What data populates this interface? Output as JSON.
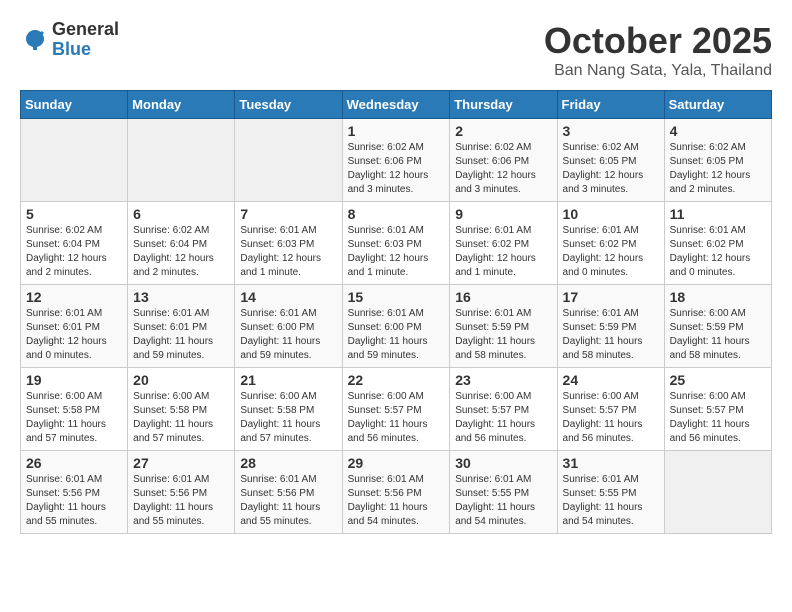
{
  "logo": {
    "general": "General",
    "blue": "Blue"
  },
  "title": "October 2025",
  "subtitle": "Ban Nang Sata, Yala, Thailand",
  "days_header": [
    "Sunday",
    "Monday",
    "Tuesday",
    "Wednesday",
    "Thursday",
    "Friday",
    "Saturday"
  ],
  "weeks": [
    [
      {
        "day": "",
        "info": ""
      },
      {
        "day": "",
        "info": ""
      },
      {
        "day": "",
        "info": ""
      },
      {
        "day": "1",
        "info": "Sunrise: 6:02 AM\nSunset: 6:06 PM\nDaylight: 12 hours\nand 3 minutes."
      },
      {
        "day": "2",
        "info": "Sunrise: 6:02 AM\nSunset: 6:06 PM\nDaylight: 12 hours\nand 3 minutes."
      },
      {
        "day": "3",
        "info": "Sunrise: 6:02 AM\nSunset: 6:05 PM\nDaylight: 12 hours\nand 3 minutes."
      },
      {
        "day": "4",
        "info": "Sunrise: 6:02 AM\nSunset: 6:05 PM\nDaylight: 12 hours\nand 2 minutes."
      }
    ],
    [
      {
        "day": "5",
        "info": "Sunrise: 6:02 AM\nSunset: 6:04 PM\nDaylight: 12 hours\nand 2 minutes."
      },
      {
        "day": "6",
        "info": "Sunrise: 6:02 AM\nSunset: 6:04 PM\nDaylight: 12 hours\nand 2 minutes."
      },
      {
        "day": "7",
        "info": "Sunrise: 6:01 AM\nSunset: 6:03 PM\nDaylight: 12 hours\nand 1 minute."
      },
      {
        "day": "8",
        "info": "Sunrise: 6:01 AM\nSunset: 6:03 PM\nDaylight: 12 hours\nand 1 minute."
      },
      {
        "day": "9",
        "info": "Sunrise: 6:01 AM\nSunset: 6:02 PM\nDaylight: 12 hours\nand 1 minute."
      },
      {
        "day": "10",
        "info": "Sunrise: 6:01 AM\nSunset: 6:02 PM\nDaylight: 12 hours\nand 0 minutes."
      },
      {
        "day": "11",
        "info": "Sunrise: 6:01 AM\nSunset: 6:02 PM\nDaylight: 12 hours\nand 0 minutes."
      }
    ],
    [
      {
        "day": "12",
        "info": "Sunrise: 6:01 AM\nSunset: 6:01 PM\nDaylight: 12 hours\nand 0 minutes."
      },
      {
        "day": "13",
        "info": "Sunrise: 6:01 AM\nSunset: 6:01 PM\nDaylight: 11 hours\nand 59 minutes."
      },
      {
        "day": "14",
        "info": "Sunrise: 6:01 AM\nSunset: 6:00 PM\nDaylight: 11 hours\nand 59 minutes."
      },
      {
        "day": "15",
        "info": "Sunrise: 6:01 AM\nSunset: 6:00 PM\nDaylight: 11 hours\nand 59 minutes."
      },
      {
        "day": "16",
        "info": "Sunrise: 6:01 AM\nSunset: 5:59 PM\nDaylight: 11 hours\nand 58 minutes."
      },
      {
        "day": "17",
        "info": "Sunrise: 6:01 AM\nSunset: 5:59 PM\nDaylight: 11 hours\nand 58 minutes."
      },
      {
        "day": "18",
        "info": "Sunrise: 6:00 AM\nSunset: 5:59 PM\nDaylight: 11 hours\nand 58 minutes."
      }
    ],
    [
      {
        "day": "19",
        "info": "Sunrise: 6:00 AM\nSunset: 5:58 PM\nDaylight: 11 hours\nand 57 minutes."
      },
      {
        "day": "20",
        "info": "Sunrise: 6:00 AM\nSunset: 5:58 PM\nDaylight: 11 hours\nand 57 minutes."
      },
      {
        "day": "21",
        "info": "Sunrise: 6:00 AM\nSunset: 5:58 PM\nDaylight: 11 hours\nand 57 minutes."
      },
      {
        "day": "22",
        "info": "Sunrise: 6:00 AM\nSunset: 5:57 PM\nDaylight: 11 hours\nand 56 minutes."
      },
      {
        "day": "23",
        "info": "Sunrise: 6:00 AM\nSunset: 5:57 PM\nDaylight: 11 hours\nand 56 minutes."
      },
      {
        "day": "24",
        "info": "Sunrise: 6:00 AM\nSunset: 5:57 PM\nDaylight: 11 hours\nand 56 minutes."
      },
      {
        "day": "25",
        "info": "Sunrise: 6:00 AM\nSunset: 5:57 PM\nDaylight: 11 hours\nand 56 minutes."
      }
    ],
    [
      {
        "day": "26",
        "info": "Sunrise: 6:01 AM\nSunset: 5:56 PM\nDaylight: 11 hours\nand 55 minutes."
      },
      {
        "day": "27",
        "info": "Sunrise: 6:01 AM\nSunset: 5:56 PM\nDaylight: 11 hours\nand 55 minutes."
      },
      {
        "day": "28",
        "info": "Sunrise: 6:01 AM\nSunset: 5:56 PM\nDaylight: 11 hours\nand 55 minutes."
      },
      {
        "day": "29",
        "info": "Sunrise: 6:01 AM\nSunset: 5:56 PM\nDaylight: 11 hours\nand 54 minutes."
      },
      {
        "day": "30",
        "info": "Sunrise: 6:01 AM\nSunset: 5:55 PM\nDaylight: 11 hours\nand 54 minutes."
      },
      {
        "day": "31",
        "info": "Sunrise: 6:01 AM\nSunset: 5:55 PM\nDaylight: 11 hours\nand 54 minutes."
      },
      {
        "day": "",
        "info": ""
      }
    ]
  ]
}
